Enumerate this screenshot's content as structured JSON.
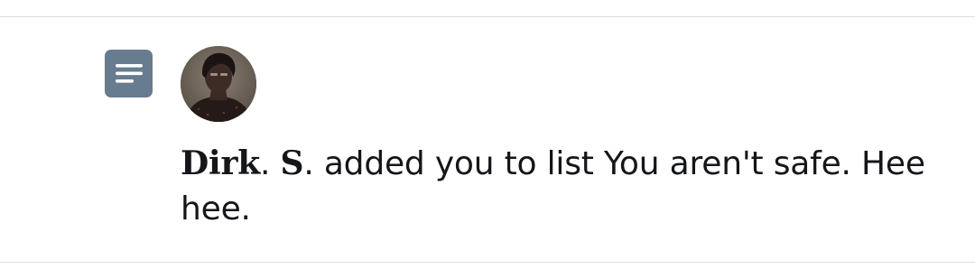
{
  "notification": {
    "icon": "list-icon",
    "avatar_icon": "avatar-portrait",
    "user_name_first": "Dirk",
    "user_name_sep1": ". ",
    "user_name_initial": "S",
    "message_text": ". added you to list You aren't safe. Hee hee."
  },
  "colors": {
    "list_icon_bg": "#687c8f",
    "text": "#141619",
    "divider": "#d9dde2"
  }
}
